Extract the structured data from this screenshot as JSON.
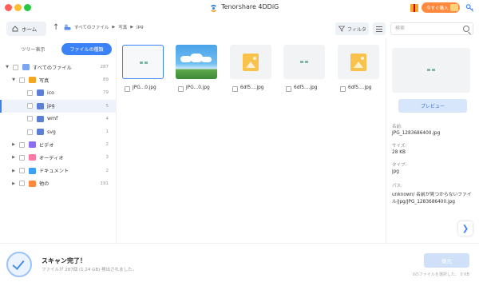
{
  "app": {
    "title": "Tenorshare 4DDiG",
    "buy_label": "今すぐ購入"
  },
  "toolbar": {
    "home_label": "ホーム",
    "breadcrumb": [
      "すべてのファイル",
      "写真",
      "jpg"
    ],
    "filter_label": "フィルタ",
    "search_placeholder": "検索"
  },
  "sidebar": {
    "tab_tree": "ツリー表示",
    "tab_filetype": "ファイルの種類",
    "items": [
      {
        "label": "すべてのファイル",
        "count": "287",
        "level": 0,
        "icon": "drive-icon"
      },
      {
        "label": "写真",
        "count": "89",
        "level": 1,
        "icon": "photo-icon"
      },
      {
        "label": "ico",
        "count": "79",
        "level": 2,
        "icon": "folder-icon"
      },
      {
        "label": "jpg",
        "count": "5",
        "level": 2,
        "icon": "folder-icon"
      },
      {
        "label": "wmf",
        "count": "4",
        "level": 2,
        "icon": "folder-icon"
      },
      {
        "label": "svg",
        "count": "1",
        "level": 2,
        "icon": "folder-icon"
      },
      {
        "label": "ビデオ",
        "count": "2",
        "level": 1,
        "icon": "video-icon"
      },
      {
        "label": "オーディオ",
        "count": "3",
        "level": 1,
        "icon": "audio-icon"
      },
      {
        "label": "ドキュメント",
        "count": "2",
        "level": 1,
        "icon": "document-icon"
      },
      {
        "label": "他の",
        "count": "191",
        "level": 1,
        "icon": "other-icon"
      }
    ]
  },
  "files": [
    {
      "name": "JPG...0.jpg",
      "thumb": "broken"
    },
    {
      "name": "JPG...0.jpg",
      "thumb": "photo"
    },
    {
      "name": "6df5....jpg",
      "thumb": "image"
    },
    {
      "name": "6df5....jpg",
      "thumb": "broken"
    },
    {
      "name": "6df5....jpg",
      "thumb": "image"
    }
  ],
  "details": {
    "preview_label": "プレビュー",
    "name_key": "名前:",
    "name_value": "JPG_1283686400.jpg",
    "size_key": "サイズ:",
    "size_value": "28 KB",
    "type_key": "タイプ:",
    "type_value": "jpg",
    "path_key": "パス:",
    "path_value": "unknown/ 名前が見つからないファイル/jpg/JPG_1283686400.jpg"
  },
  "status": {
    "title": "スキャン完了！",
    "subtitle": "ファイルが 287個 (1.24 GB) 検出されました。",
    "recover_label": "復元",
    "selection": "0のファイルを選択した、 0 KB"
  }
}
